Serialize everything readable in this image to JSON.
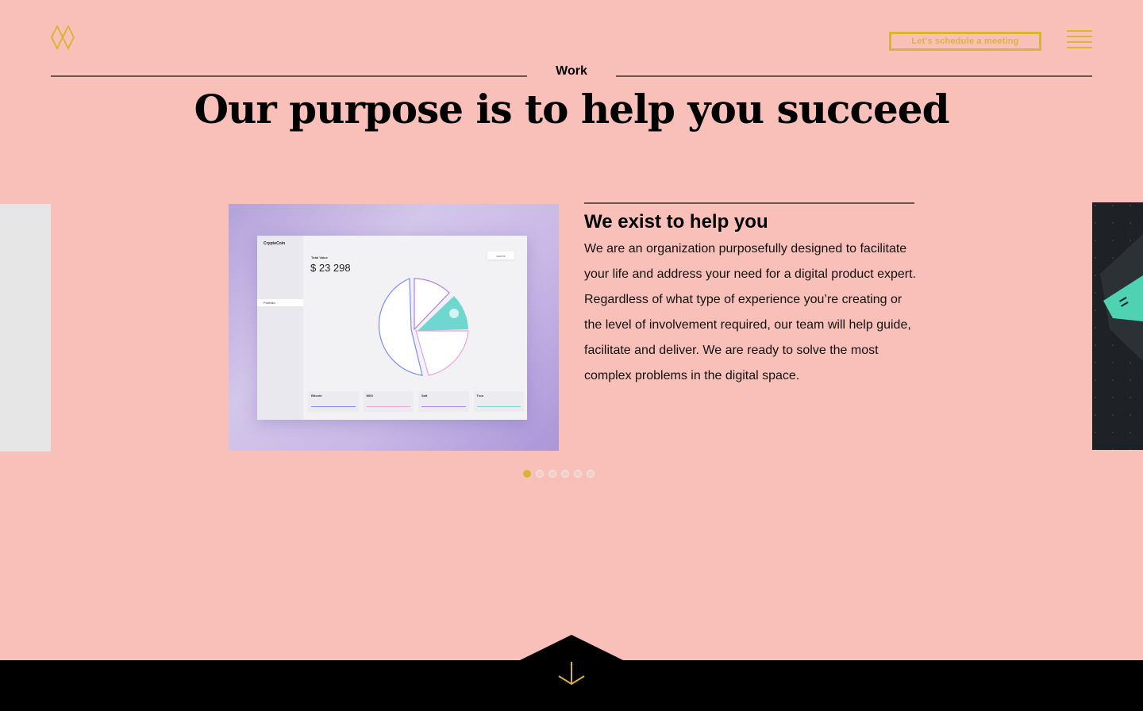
{
  "header": {
    "logo_icon": "diamond-pair-logo",
    "cta_label": "Let's schedule a meeting",
    "menu_icon": "hamburger-menu-icon",
    "accent_color": "#d8b53a"
  },
  "section": {
    "label": "Work",
    "headline": "Our purpose is to help you succeed"
  },
  "project": {
    "image": {
      "app_name": "CryptoCoin",
      "nav_items": [
        "Portfolio"
      ],
      "total_label": "Total Value",
      "total_value": "$ 23 298",
      "select_label": "assets",
      "tickers": [
        {
          "name": "Bitcoin",
          "color": "#7b8cf0"
        },
        {
          "name": "NEO",
          "color": "#e7a3d8"
        },
        {
          "name": "Salt",
          "color": "#b57ee8"
        },
        {
          "name": "Tron",
          "color": "#6fd6d0"
        }
      ]
    },
    "title": "We exist to help you",
    "body": "We are an organization purposefully designed to facilitate your life and address your need for a digital product expert. Regardless of what type of experience you’re creating or the level of involvement required, our team will help guide, facilitate and deliver. We are ready to solve the most complex problems in the digital space."
  },
  "carousel": {
    "total": 6,
    "active_index": 0
  },
  "footer": {
    "scroll_icon": "arrow-down-icon",
    "background": "#000000"
  }
}
